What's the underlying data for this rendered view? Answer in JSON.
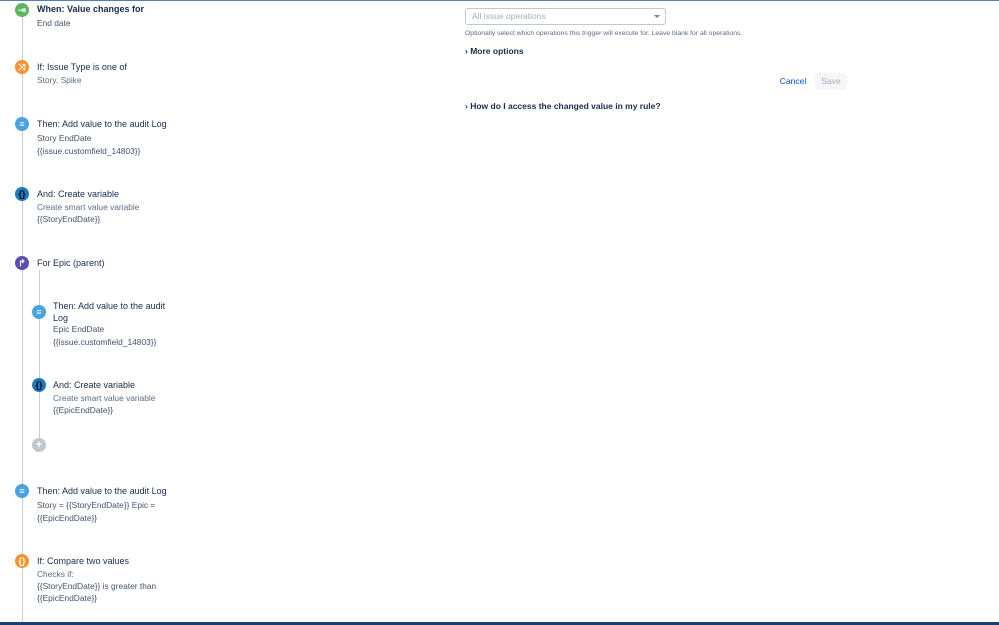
{
  "trigger_form": {
    "operations_select": {
      "value": "All issue operations"
    },
    "help_text": "Optionally select which operations this trigger will execute for. Leave blank for all operations.",
    "more_options": "More options",
    "cancel": "Cancel",
    "save": "Save",
    "faq": "How do I access the changed value in my rule?"
  },
  "rule": {
    "steps": [
      {
        "icon": "trigger-icon",
        "color": "#5cb85c",
        "title": "When: Value changes for",
        "lines": [
          "End date"
        ]
      },
      {
        "icon": "shuffle-icon",
        "color": "#f79232",
        "title": "If: Issue Type is one of",
        "lines": [
          "Story, Spike"
        ]
      },
      {
        "icon": "log-icon",
        "color": "#4aa3df",
        "title": "Then: Add value to the audit Log",
        "lines": [
          "Story EndDate",
          "{{issue.customfield_14803}}"
        ]
      },
      {
        "icon": "braces-icon",
        "color": "#1d7ac0",
        "title": "And: Create variable",
        "lines": [
          "Create smart value variable",
          "{{StoryEndDate}}"
        ]
      },
      {
        "icon": "branch-icon",
        "color": "#5e4db2",
        "title": "For Epic (parent)",
        "lines": []
      },
      {
        "icon": "log-icon",
        "color": "#4aa3df",
        "title": "Then: Add value to the audit",
        "title2": "Log",
        "lines": [
          "Epic EndDate",
          "{{issue.customfield_14803}}"
        ]
      },
      {
        "icon": "braces-icon",
        "color": "#1d7ac0",
        "title": "And: Create variable",
        "lines": [
          "Create smart value variable",
          "{{EpicEndDate}}"
        ]
      },
      {
        "icon": "log-icon",
        "color": "#4aa3df",
        "title": "Then: Add value to the audit Log",
        "lines": [
          "Story = {{StoryEndDate}} Epic =",
          "{{EpicEndDate}}"
        ]
      },
      {
        "icon": "braces-icon",
        "color": "#f79232",
        "title": "If: Compare two values",
        "lines": [
          "Checks if:",
          "{{StoryEndDate}} is greater than",
          "{{EpicEndDate}}"
        ]
      }
    ]
  }
}
